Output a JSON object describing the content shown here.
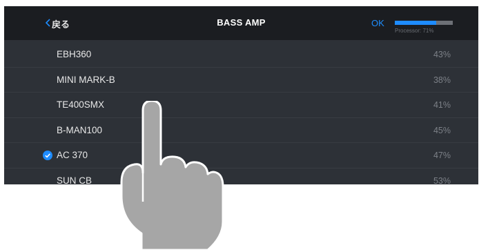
{
  "header": {
    "back_label": "戻る",
    "title": "BASS AMP",
    "ok_label": "OK",
    "processor_label": "Processor: 71%",
    "processor_fraction": 0.71
  },
  "amps": [
    {
      "name": "EBH360",
      "percent": "43%",
      "selected": false
    },
    {
      "name": "MINI MARK-B",
      "percent": "38%",
      "selected": false
    },
    {
      "name": "TE400SMX",
      "percent": "41%",
      "selected": false
    },
    {
      "name": "B-MAN100",
      "percent": "45%",
      "selected": false
    },
    {
      "name": "AC 370",
      "percent": "47%",
      "selected": true
    },
    {
      "name": "SUN CB",
      "percent": "53%",
      "selected": false
    }
  ],
  "colors": {
    "accent": "#1e8cff",
    "header_bg": "#1b1d21",
    "list_bg": "#2d3137",
    "hand": "#a6a6a6"
  },
  "icons": {
    "back": "chevron-left-icon",
    "selected": "checkmark-circle-icon",
    "gesture": "tap-hand-icon"
  }
}
